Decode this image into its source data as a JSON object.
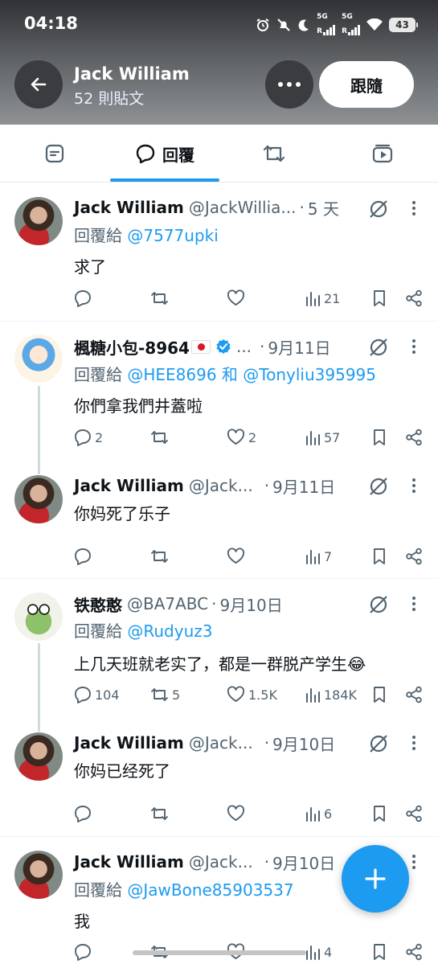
{
  "status_bar": {
    "time": "04:18",
    "network_1": "5G",
    "network_2": "5G",
    "sim_1": "R",
    "sim_2": "R",
    "battery": "43"
  },
  "profile_header": {
    "name": "Jack William",
    "post_count": "52 則貼文",
    "follow_label": "跟隨"
  },
  "tabs": {
    "replies_label": "回覆"
  },
  "colors": {
    "accent": "#1d9bf0",
    "text": "#0f1419",
    "secondary": "#536471"
  },
  "tweets": [
    {
      "name": "Jack William",
      "handle": "@JackWillia...",
      "date": "5 天",
      "reply_prefix": "回覆給",
      "reply_to": "@7577upki",
      "text": "求了",
      "replies": "",
      "retweets": "",
      "likes": "",
      "views": "21"
    },
    {
      "name": "楓糖小包-8964",
      "handle": "...",
      "date": "9月11日",
      "reply_prefix": "回覆給",
      "reply_to": "@HEE8696 和 @Tonyliu395995",
      "text": "你們拿我們井蓋啦",
      "replies": "2",
      "retweets": "",
      "likes": "2",
      "views": "57"
    },
    {
      "name": "Jack William",
      "handle": "@Jack...",
      "date": "9月11日",
      "text": "你妈死了乐子",
      "replies": "",
      "retweets": "",
      "likes": "",
      "views": "7"
    },
    {
      "name": "铁憨憨",
      "handle": "@BA7ABC",
      "date": "9月10日",
      "reply_prefix": "回覆給",
      "reply_to": "@Rudyuz3",
      "text": "上几天班就老实了，都是一群脱产学生😂",
      "replies": "104",
      "retweets": "5",
      "likes": "1.5K",
      "views": "184K"
    },
    {
      "name": "Jack William",
      "handle": "@Jack...",
      "date": "9月10日",
      "text": "你妈已经死了",
      "replies": "",
      "retweets": "",
      "likes": "",
      "views": "6"
    },
    {
      "name": "Jack William",
      "handle": "@Jack...",
      "date": "9月10日",
      "reply_prefix": "回覆給",
      "reply_to": "@JawBone85903537",
      "text": "我",
      "replies": "",
      "retweets": "",
      "likes": "",
      "views": "4"
    }
  ]
}
